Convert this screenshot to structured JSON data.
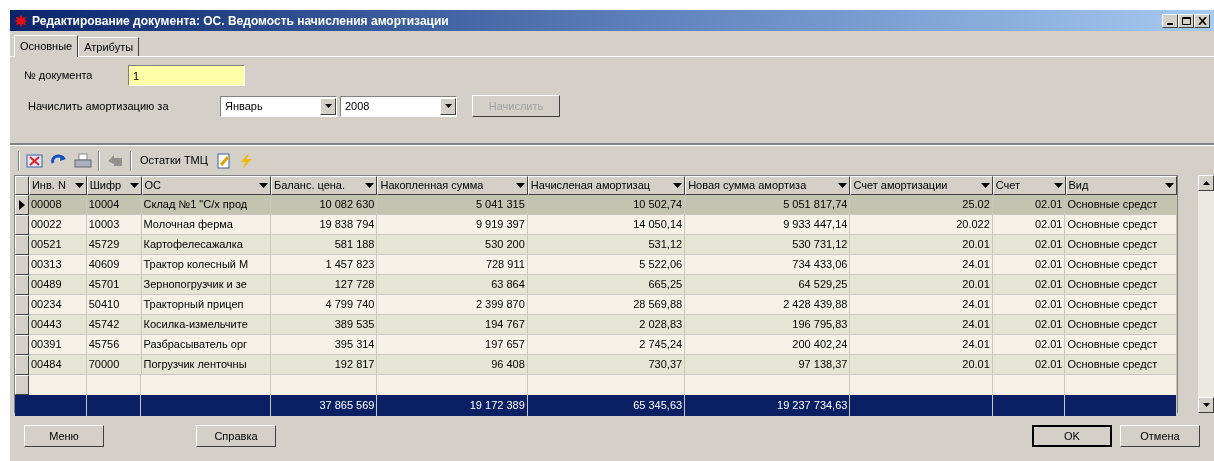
{
  "window": {
    "title": "Редактирование документа: ОС. Ведомость начисления амортизации"
  },
  "tabs": [
    {
      "label": "Основные",
      "selected": true
    },
    {
      "label": "Атрибуты",
      "selected": false
    }
  ],
  "doc_number": {
    "label": "№ документа",
    "value": "1"
  },
  "period": {
    "label": "Начислить амортизацию за",
    "month": "Январь",
    "year": "2008",
    "button": {
      "label": "Начислить",
      "disabled": true
    }
  },
  "toolbar": {
    "label": "Остатки ТМЦ"
  },
  "table": {
    "columns": [
      {
        "label": "Инв. N"
      },
      {
        "label": "Шифр"
      },
      {
        "label": "ОС"
      },
      {
        "label": "Баланс. цена."
      },
      {
        "label": "Накопленная сумма"
      },
      {
        "label": "Начисленая амортизац"
      },
      {
        "label": "Новая сумма амортиза"
      },
      {
        "label": "Счет амортизации"
      },
      {
        "label": "Счет"
      },
      {
        "label": "Вид"
      }
    ],
    "rows": [
      {
        "selected": true,
        "cells": [
          "00008",
          "10004",
          "Склад №1 \"С/х прод",
          "10 082 630",
          "5 041 315",
          "10 502,74",
          "5 051 817,74",
          "25.02",
          "02.01",
          "Основные средст"
        ]
      },
      {
        "selected": false,
        "cells": [
          "00022",
          "10003",
          "Молочная ферма",
          "19 838 794",
          "9 919 397",
          "14 050,14",
          "9 933 447,14",
          "20.022",
          "02.01",
          "Основные средст"
        ]
      },
      {
        "selected": false,
        "cells": [
          "00521",
          "45729",
          "Картофелесажалка",
          "581 188",
          "530 200",
          "531,12",
          "530 731,12",
          "20.01",
          "02.01",
          "Основные средст"
        ]
      },
      {
        "selected": false,
        "cells": [
          "00313",
          "40609",
          "Трактор колесный М",
          "1 457 823",
          "728 911",
          "5 522,06",
          "734 433,06",
          "24.01",
          "02.01",
          "Основные средст"
        ]
      },
      {
        "selected": false,
        "cells": [
          "00489",
          "45701",
          "Зернопогрузчик и зе",
          "127 728",
          "63 864",
          "665,25",
          "64 529,25",
          "20.01",
          "02.01",
          "Основные средст"
        ]
      },
      {
        "selected": false,
        "cells": [
          "00234",
          "50410",
          "Тракторный прицеп",
          "4 799 740",
          "2 399 870",
          "28 569,88",
          "2 428 439,88",
          "24.01",
          "02.01",
          "Основные средст"
        ]
      },
      {
        "selected": false,
        "cells": [
          "00443",
          "45742",
          "Косилка-измельчите",
          "389 535",
          "194 767",
          "2 028,83",
          "196 795,83",
          "24.01",
          "02.01",
          "Основные средст"
        ]
      },
      {
        "selected": false,
        "cells": [
          "00391",
          "45756",
          "Разбрасыватель орг",
          "395 314",
          "197 657",
          "2 745,24",
          "200 402,24",
          "24.01",
          "02.01",
          "Основные средст"
        ]
      },
      {
        "selected": false,
        "cells": [
          "00484",
          "70000",
          "Погрузчик ленточны",
          "192 817",
          "96 408",
          "730,37",
          "97 138,37",
          "20.01",
          "02.01",
          "Основные средст"
        ]
      }
    ],
    "totals": [
      "37 865 569",
      "19 172 389",
      "65 345,63",
      "19 237 734,63"
    ]
  },
  "buttons": [
    {
      "label": "Меню",
      "default": false
    },
    {
      "label": "Справка",
      "default": false
    },
    {
      "label": "OK",
      "default": true
    },
    {
      "label": "Отмена",
      "default": false
    }
  ]
}
